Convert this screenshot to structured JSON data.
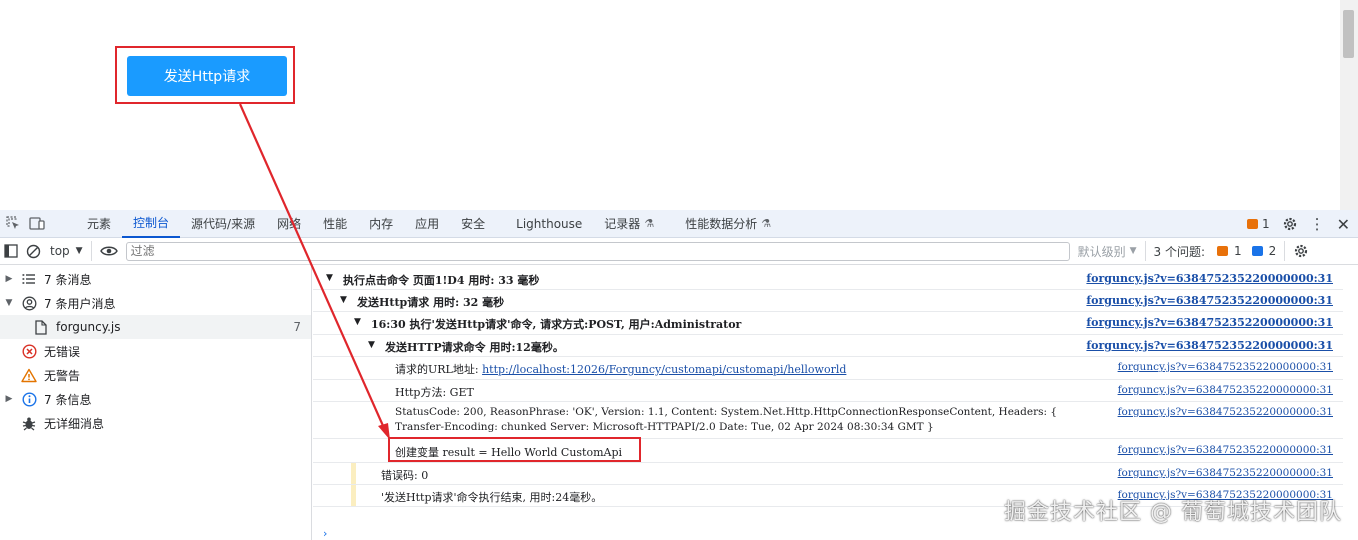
{
  "page": {
    "send_button": "发送Http请求"
  },
  "devtools": {
    "tabs": [
      {
        "label": "元素"
      },
      {
        "label": "控制台",
        "active": true
      },
      {
        "label": "源代码/来源"
      },
      {
        "label": "网络"
      },
      {
        "label": "性能"
      },
      {
        "label": "内存"
      },
      {
        "label": "应用"
      },
      {
        "label": "安全"
      },
      {
        "label": "Lighthouse"
      },
      {
        "label": "记录器"
      },
      {
        "label": "性能数据分析"
      }
    ],
    "issue_badge_count": "1"
  },
  "console_toolbar": {
    "context": "top",
    "filter_placeholder": "过滤",
    "levels": "默认级别",
    "issues_label": "3 个问题:",
    "issues_warn": "1",
    "issues_info": "2"
  },
  "sidebar": {
    "items": [
      {
        "label": "7 条消息",
        "icon": "list-icon"
      },
      {
        "label": "7 条用户消息",
        "icon": "user-icon"
      },
      {
        "label": "forguncy.js",
        "icon": "file-icon",
        "count": "7"
      },
      {
        "label": "无错误",
        "icon": "error-icon"
      },
      {
        "label": "无警告",
        "icon": "warning-icon"
      },
      {
        "label": "7 条信息",
        "icon": "info-icon"
      },
      {
        "label": "无详细消息",
        "icon": "bug-icon"
      }
    ]
  },
  "log": {
    "rows": [
      {
        "text": "执行点击命令 页面1!D4 用时: 33 毫秒",
        "source": "forguncy.js?v=638475235220000000:31"
      },
      {
        "text": "发送Http请求 用时: 32 毫秒",
        "source": "forguncy.js?v=638475235220000000:31"
      },
      {
        "text": "16:30 执行'发送Http请求'命令, 请求方式:POST, 用户:Administrator",
        "source": "forguncy.js?v=638475235220000000:31"
      },
      {
        "text": "发送HTTP请求命令 用时:12毫秒。",
        "source": "forguncy.js?v=638475235220000000:31"
      },
      {
        "text": "请求的URL地址: ",
        "link": "http://localhost:12026/Forguncy/customapi/customapi/helloworld",
        "source": "forguncy.js?v=638475235220000000:31"
      },
      {
        "text": "Http方法: GET",
        "source": "forguncy.js?v=638475235220000000:31"
      },
      {
        "text": "StatusCode: 200, ReasonPhrase: 'OK', Version: 1.1, Content: System.Net.Http.HttpConnectionResponseContent, Headers: {",
        "text2": "Transfer-Encoding: chunked   Server: Microsoft-HTTPAPI/2.0   Date: Tue, 02 Apr 2024 08:30:34 GMT }",
        "source": "forguncy.js?v=638475235220000000:31"
      },
      {
        "text": "创建变量 result = Hello World CustomApi",
        "source": "forguncy.js?v=638475235220000000:31"
      },
      {
        "text": "错误码: 0",
        "source": "forguncy.js?v=638475235220000000:31"
      },
      {
        "text": "'发送Http请求'命令执行结束, 用时:24毫秒。",
        "source": "forguncy.js?v=638475235220000000:31"
      }
    ]
  },
  "watermark": "掘金技术社区 @ 葡萄城技术团队",
  "colors": {
    "primary_button": "#1a9bff",
    "highlight_box": "#e0262c",
    "link": "#1a4fa8",
    "active_tab": "#0b57d0"
  }
}
